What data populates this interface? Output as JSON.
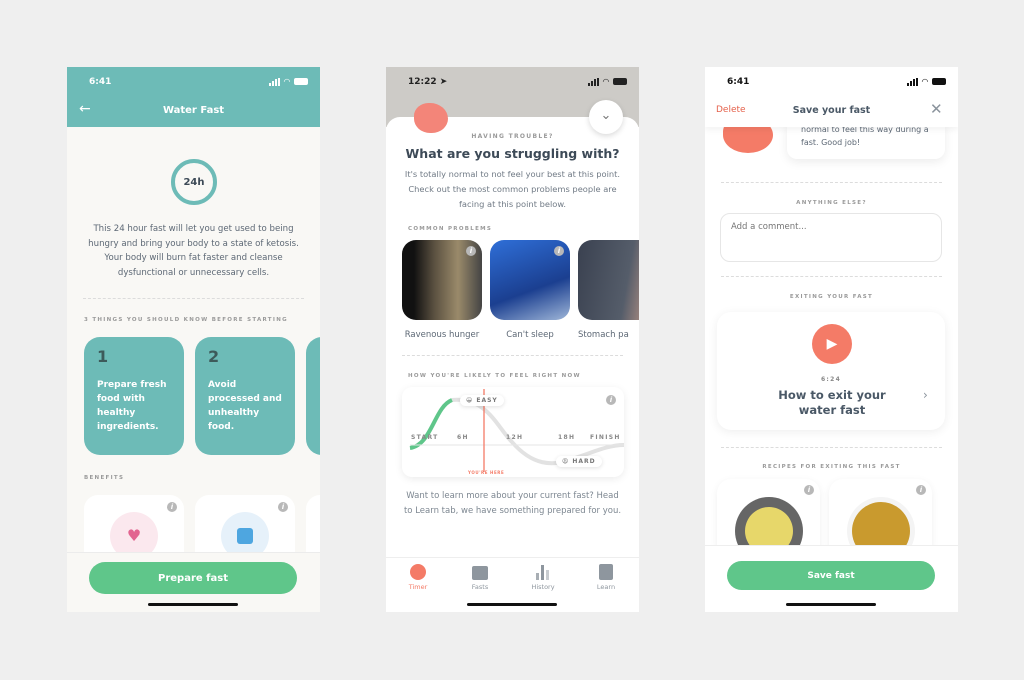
{
  "screens": [
    {
      "status_time": "6:41",
      "title": "Water Fast",
      "duration": "24h",
      "description": "This 24 hour fast will let you get used to being hungry and bring your body to a state of ketosis. Your body will burn fat faster and cleanse dysfunctional or unnecessary cells.",
      "things_label": "3 things you should know before starting",
      "things": [
        {
          "num": "1",
          "text": "Prepare fresh food with healthy ingredients."
        },
        {
          "num": "2",
          "text": "Avoid processed and unhealthy food."
        }
      ],
      "benefits_label": "Benefits",
      "benefit_icons": [
        "heart-icon",
        "scale-icon"
      ],
      "button": "Prepare fast",
      "colors": {
        "header": "#6dbbb7",
        "card": "#6dbbb7",
        "button": "#5fc68a"
      }
    },
    {
      "status_time": "12:22",
      "eyebrow": "Having trouble?",
      "title": "What are you struggling with?",
      "description": "It's totally normal to not feel your best at this point. Check out the most common problems people are facing at this point below.",
      "problems_label": "Common problems",
      "problems": [
        "Ravenous hunger",
        "Can't sleep",
        "Stomach pa"
      ],
      "feel_label": "How you're likely to feel right now",
      "feel_chart": {
        "ticks": [
          "START",
          "6H",
          "12H",
          "18H",
          "FINISH"
        ],
        "easy": "EASY",
        "hard": "HARD",
        "marker": "YOU'RE HERE"
      },
      "learn_text": "Want to learn more about your current fast? Head to Learn tab, we have something prepared for you.",
      "tabs": [
        {
          "label": "Timer",
          "active": true
        },
        {
          "label": "Fasts"
        },
        {
          "label": "History"
        },
        {
          "label": "Learn"
        }
      ],
      "colors": {
        "accent": "#f47b67",
        "easy": "#5fc68a"
      }
    },
    {
      "status_time": "6:41",
      "delete": "Delete",
      "title": "Save your fast",
      "bubble": "normal to feel this way during a fast. Good job!",
      "anything_label": "Anything else?",
      "comment_placeholder": "Add a comment...",
      "exiting_label": "Exiting your fast",
      "video_duration": "6:24",
      "video_title": "How to exit your water fast",
      "recipes_label": "Recipes for exiting this fast",
      "button": "Save fast"
    }
  ]
}
